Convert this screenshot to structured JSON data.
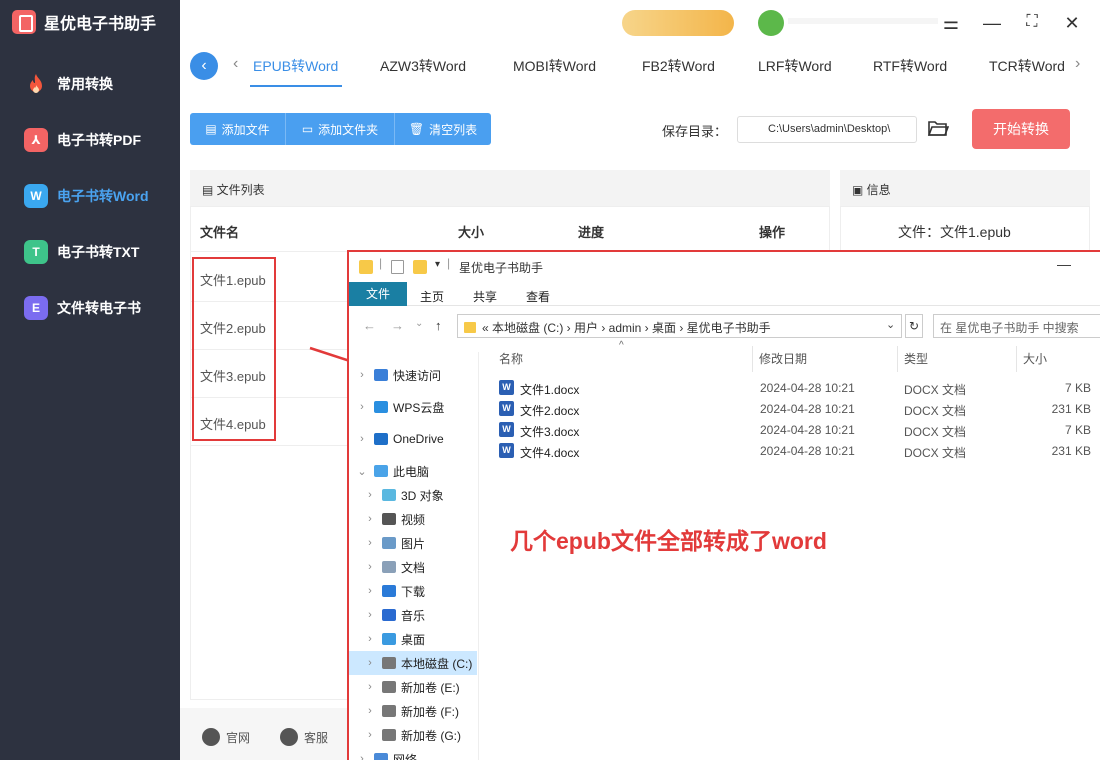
{
  "app": {
    "title": "星优电子书助手"
  },
  "sidebar": {
    "items": [
      {
        "label": "常用转换",
        "icon": "flame-icon",
        "color": "#f36c4c"
      },
      {
        "label": "电子书转PDF",
        "icon": "pdf-icon",
        "color": "#f36464"
      },
      {
        "label": "电子书转Word",
        "icon": "word-icon",
        "color": "#3aa8f0",
        "active": true
      },
      {
        "label": "电子书转TXT",
        "icon": "txt-icon",
        "color": "#3ec48a"
      },
      {
        "label": "文件转电子书",
        "icon": "ebook-icon",
        "color": "#7b6cf0"
      }
    ]
  },
  "tabs": {
    "items": [
      "EPUB转Word",
      "AZW3转Word",
      "MOBI转Word",
      "FB2转Word",
      "LRF转Word",
      "RTF转Word",
      "TCR转Word"
    ],
    "active": 0
  },
  "toolbar": {
    "add_file": "添加文件",
    "add_folder": "添加文件夹",
    "clear_list": "清空列表"
  },
  "save": {
    "label": "保存目录：",
    "path": "C:\\Users\\admin\\Desktop\\",
    "start": "开始转换"
  },
  "filelist": {
    "title": "文件列表",
    "columns": [
      "文件名",
      "大小",
      "进度",
      "操作"
    ],
    "files": [
      "文件1.epub",
      "文件2.epub",
      "文件3.epub",
      "文件4.epub"
    ]
  },
  "info": {
    "title": "信息",
    "file_label": "文件：",
    "file": "文件1.epub"
  },
  "footer": {
    "website": "官网",
    "service": "客服"
  },
  "explorer": {
    "title": "星优电子书助手",
    "menu": [
      "文件",
      "主页",
      "共享",
      "查看"
    ],
    "address": "«  本地磁盘 (C:)  ›  用户  ›  admin  ›  桌面  ›  星优电子书助手",
    "search_placeholder": "在 星优电子书助手 中搜索",
    "columns": [
      "名称",
      "修改日期",
      "类型",
      "大小"
    ],
    "tree": [
      {
        "label": "快速访问",
        "color": "#3a7fd8"
      },
      {
        "label": "WPS云盘",
        "color": "#2a8fe0"
      },
      {
        "label": "OneDrive",
        "color": "#1e6fc8"
      },
      {
        "label": "此电脑",
        "color": "#4aa3e8"
      },
      {
        "label": "3D 对象",
        "color": "#5ab8e0"
      },
      {
        "label": "视频",
        "color": "#555"
      },
      {
        "label": "图片",
        "color": "#6a9ac8"
      },
      {
        "label": "文档",
        "color": "#8aa0b8"
      },
      {
        "label": "下载",
        "color": "#2a7ad8"
      },
      {
        "label": "音乐",
        "color": "#2a6ad0"
      },
      {
        "label": "桌面",
        "color": "#3a9ae0"
      },
      {
        "label": "本地磁盘 (C:)",
        "color": "#777"
      },
      {
        "label": "新加卷 (E:)",
        "color": "#777"
      },
      {
        "label": "新加卷 (F:)",
        "color": "#777"
      },
      {
        "label": "新加卷 (G:)",
        "color": "#777"
      },
      {
        "label": "网络",
        "color": "#4a8ad8"
      }
    ],
    "files": [
      {
        "name": "文件1.docx",
        "date": "2024-04-28 10:21",
        "type": "DOCX 文档",
        "size": "7 KB"
      },
      {
        "name": "文件2.docx",
        "date": "2024-04-28 10:21",
        "type": "DOCX 文档",
        "size": "231 KB"
      },
      {
        "name": "文件3.docx",
        "date": "2024-04-28 10:21",
        "type": "DOCX 文档",
        "size": "7 KB"
      },
      {
        "name": "文件4.docx",
        "date": "2024-04-28 10:21",
        "type": "DOCX 文档",
        "size": "231 KB"
      }
    ]
  },
  "annotation": "几个epub文件全部转成了word"
}
